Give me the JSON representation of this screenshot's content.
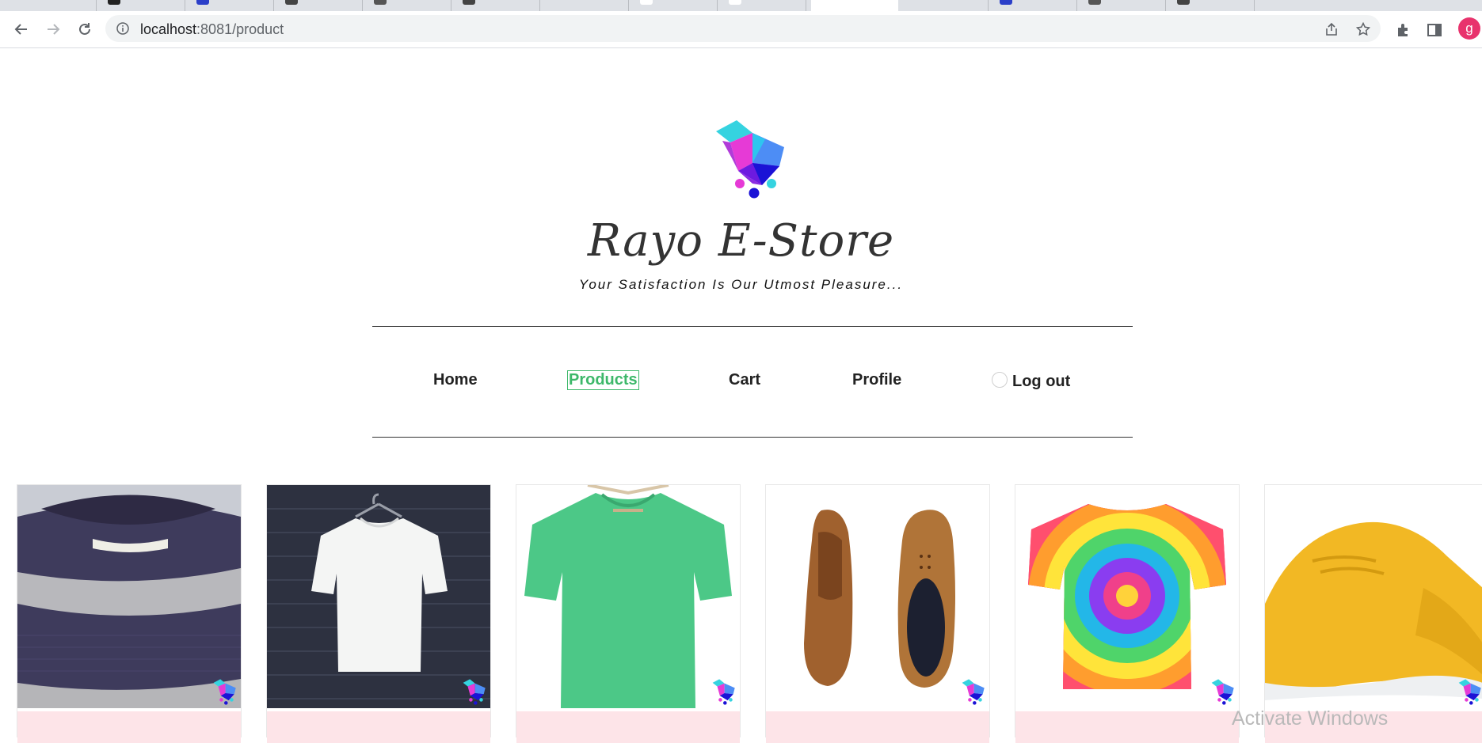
{
  "browser": {
    "url_host": "localhost",
    "url_rest": ":8081/product",
    "profile_initial": "g"
  },
  "site": {
    "title": "Rayo E-Store",
    "tagline": "Your Satisfaction Is Our Utmost Pleasure..."
  },
  "menu": {
    "home": "Home",
    "products": "Products",
    "cart": "Cart",
    "profile": "Profile",
    "logout": "Log out"
  },
  "products": [
    {
      "image": "striped-knit-sweater-image"
    },
    {
      "image": "white-tshirt-on-hanger-image"
    },
    {
      "image": "green-tshirt-on-hanger-image"
    },
    {
      "image": "brown-leather-oxford-shoes-image"
    },
    {
      "image": "tie-dye-tshirt-image"
    },
    {
      "image": "yellow-sneakers-image"
    }
  ],
  "os_watermark": "Activate Windows",
  "colors": {
    "accent_green": "#3db86a",
    "caption_pink": "#fde4e8",
    "logo_magenta": "#e63ad6",
    "logo_cyan": "#35d3e0",
    "logo_blue": "#1b12d6"
  }
}
